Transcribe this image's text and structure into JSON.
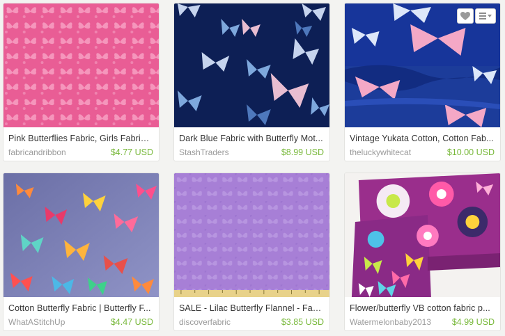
{
  "listings": [
    {
      "title": "Pink Butterflies Fabric, Girls Fabric,...",
      "shop": "fabricandribbon",
      "price": "$4.77 USD",
      "image": "pink-butterfly-fabric"
    },
    {
      "title": "Dark Blue Fabric with Butterfly Mot...",
      "shop": "StashTraders",
      "price": "$8.99 USD",
      "image": "dark-blue-butterfly-fabric"
    },
    {
      "title": "Vintage Yukata Cotton, Cotton Fab...",
      "shop": "theluckywhitecat",
      "price": "$10.00 USD",
      "image": "yukata-butterfly-fabric"
    },
    {
      "title": "Cotton Butterfly Fabric | Butterfly F...",
      "shop": "WhatAStitchUp",
      "price": "$4.47 USD",
      "image": "rainbow-butterfly-fabric"
    },
    {
      "title": "SALE - Lilac Butterfly Flannel - Fabr...",
      "shop": "discoverfabric",
      "price": "$3.85 USD",
      "image": "lilac-butterfly-flannel"
    },
    {
      "title": "Flower/butterfly VB cotton fabric p...",
      "shop": "Watermelonbaby2013",
      "price": "$4.99 USD",
      "image": "purple-floral-butterfly-fabric"
    }
  ],
  "hover_actions": {
    "favorite_icon": "heart-icon",
    "menu_icon": "list-menu-icon"
  },
  "colors": {
    "price": "#78b83a",
    "shop": "#9a9a9a",
    "title": "#333333",
    "background": "#f3f3f1"
  }
}
